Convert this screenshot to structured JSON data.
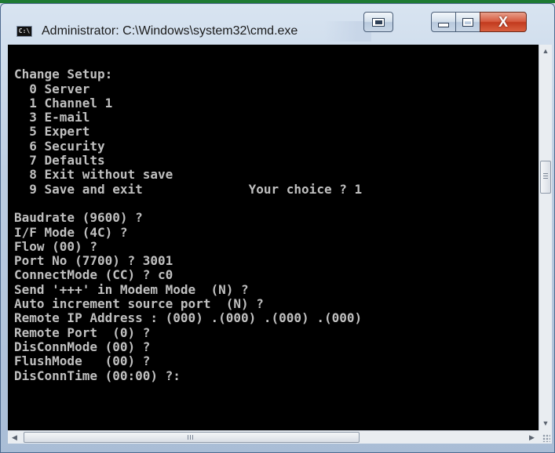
{
  "window": {
    "title": "Administrator: C:\\Windows\\system32\\cmd.exe",
    "icon_name": "cmd-icon",
    "icon_label": "C:\\"
  },
  "titlebar_buttons": {
    "mode_icon": "window-mode-icon",
    "minimize_icon": "minimize-icon",
    "maximize_icon": "maximize-icon",
    "close_icon": "close-icon",
    "close_glyph": "X"
  },
  "console": {
    "lines": [
      "",
      "Change Setup:",
      "  0 Server",
      "  1 Channel 1",
      "  3 E-mail",
      "  5 Expert",
      "  6 Security",
      "  7 Defaults",
      "  8 Exit without save",
      "  9 Save and exit              Your choice ? 1",
      "",
      "Baudrate (9600) ?",
      "I/F Mode (4C) ?",
      "Flow (00) ?",
      "Port No (7700) ? 3001",
      "ConnectMode (CC) ? c0",
      "Send '+++' in Modem Mode  (N) ?",
      "Auto increment source port  (N) ?",
      "Remote IP Address : (000) .(000) .(000) .(000)",
      "Remote Port  (0) ?",
      "DisConnMode (00) ?",
      "FlushMode   (00) ?",
      "DisConnTime (00:00) ?:"
    ]
  },
  "scrollbars": {
    "vertical": {
      "up_arrow": "▲",
      "down_arrow": "▼"
    },
    "horizontal": {
      "left_arrow": "◀",
      "right_arrow": "▶",
      "thumb_grip": "III"
    }
  },
  "colors": {
    "console_bg": "#000000",
    "console_fg": "#c0c0c0",
    "close_button": "#c8452a"
  }
}
